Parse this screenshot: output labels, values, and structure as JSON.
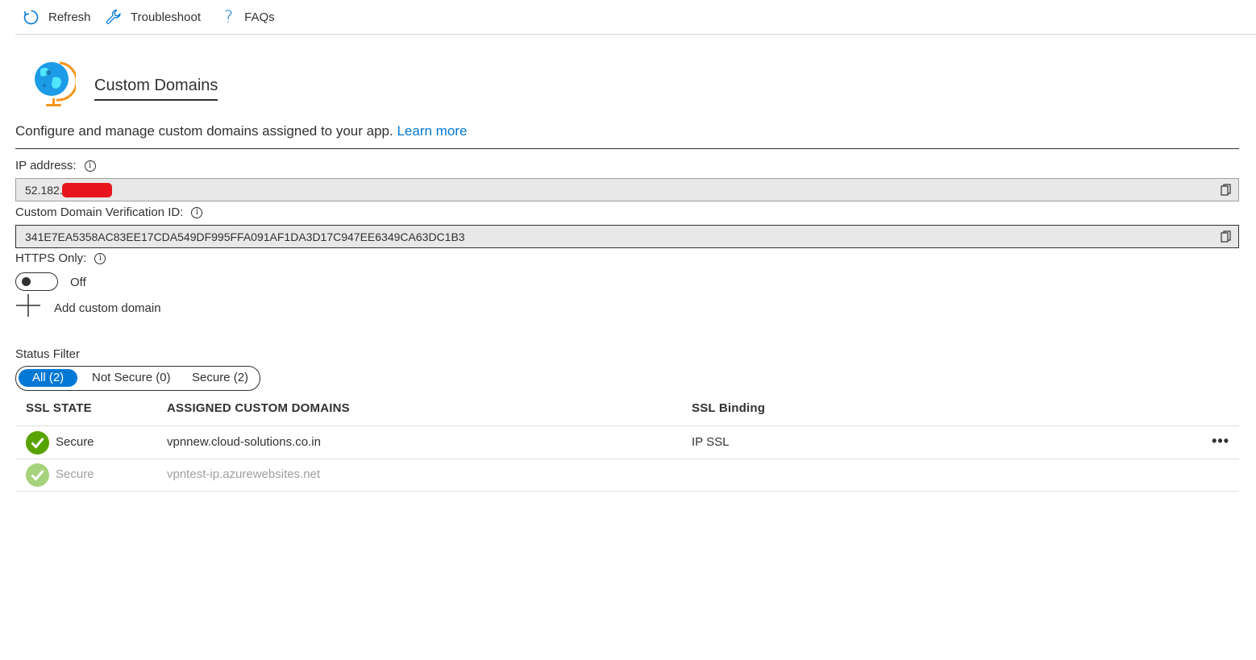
{
  "toolbar": {
    "refresh_label": "Refresh",
    "troubleshoot_label": "Troubleshoot",
    "faqs_label": "FAQs"
  },
  "header": {
    "title": "Custom Domains",
    "description": "Configure and manage custom domains assigned to your app.",
    "learn_more": "Learn more",
    "icon": "globe-icon"
  },
  "ip_address": {
    "label": "IP address:",
    "value": "52.182."
  },
  "verification_id": {
    "label": "Custom Domain Verification ID:",
    "value": "341E7EA5358AC83EE17CDA549DF995FFA091AF1DA3D17C947EE6349CA63DC1B3"
  },
  "https_only": {
    "label": "HTTPS Only:",
    "state": "Off"
  },
  "add_domain_label": "Add custom domain",
  "status_filter": {
    "label": "Status Filter",
    "options": [
      "All (2)",
      "Not Secure (0)",
      "Secure (2)"
    ],
    "selected": "All (2)"
  },
  "table": {
    "columns": [
      "SSL STATE",
      "ASSIGNED CUSTOM DOMAINS",
      "SSL Binding"
    ],
    "rows": [
      {
        "ssl_state": "Secure",
        "domain": "vpnnew.cloud-solutions.co.in",
        "binding": "IP SSL"
      },
      {
        "ssl_state": "Secure",
        "domain": "vpntest-ip.azurewebsites.net",
        "binding": ""
      }
    ]
  },
  "colors": {
    "accent": "#0078d4",
    "secure_green": "#57a300",
    "secure_green_dim": "#a6d37b",
    "redaction": "#e8141c"
  }
}
